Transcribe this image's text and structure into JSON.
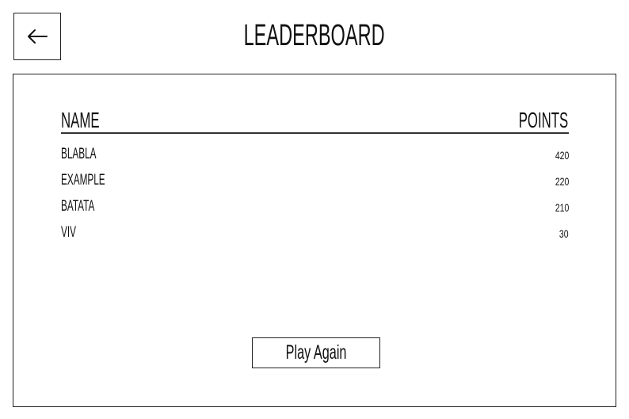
{
  "header": {
    "title": "LEADERBOARD",
    "back_icon": "arrow-left-icon"
  },
  "table": {
    "columns": [
      "NAME",
      "POINTS"
    ],
    "rows": [
      {
        "name": "BLABLA",
        "points": "420"
      },
      {
        "name": "EXAMPLE",
        "points": "220"
      },
      {
        "name": "BATATA",
        "points": "210"
      },
      {
        "name": "VIV",
        "points": "30"
      }
    ]
  },
  "actions": {
    "play_again_label": "Play Again"
  }
}
